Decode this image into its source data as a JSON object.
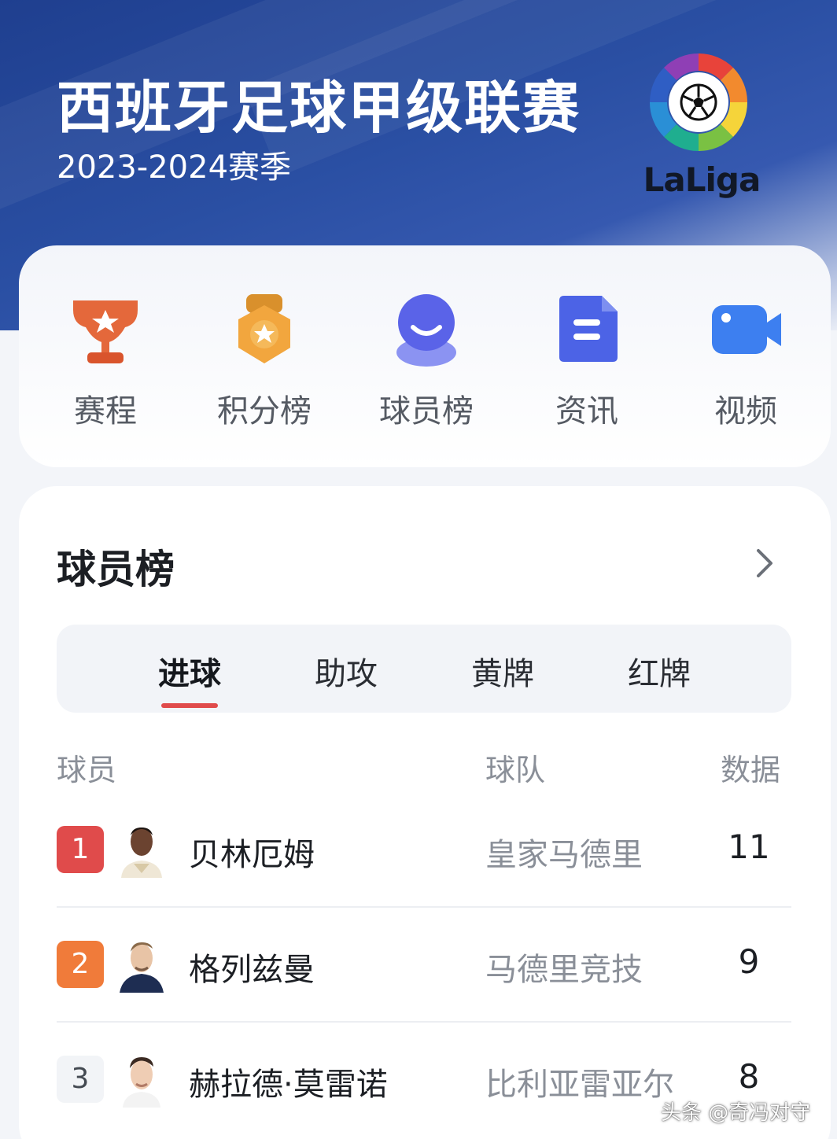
{
  "header": {
    "title": "西班牙足球甲级联赛",
    "season": "2023-2024赛季",
    "logo_text": "LaLiga"
  },
  "nav": [
    {
      "label": "赛程",
      "icon": "trophy-icon"
    },
    {
      "label": "积分榜",
      "icon": "medal-icon"
    },
    {
      "label": "球员榜",
      "icon": "player-icon"
    },
    {
      "label": "资讯",
      "icon": "news-icon"
    },
    {
      "label": "视频",
      "icon": "video-camera-icon"
    }
  ],
  "leaderboard": {
    "title": "球员榜",
    "tabs": [
      "进球",
      "助攻",
      "黄牌",
      "红牌"
    ],
    "active_tab": "进球",
    "columns": {
      "player": "球员",
      "team": "球队",
      "stat": "数据"
    },
    "rows": [
      {
        "rank": "1",
        "name": "贝林厄姆",
        "team": "皇家马德里",
        "value": "11",
        "rank_color": "#e04b4b"
      },
      {
        "rank": "2",
        "name": "格列兹曼",
        "team": "马德里竞技",
        "value": "9",
        "rank_color": "#f07b3a"
      },
      {
        "rank": "3",
        "name": "赫拉德·莫雷诺",
        "team": "比利亚雷亚尔",
        "value": "8",
        "rank_color": "#f2f4f7"
      }
    ]
  },
  "watermark": "头条 @奇冯对守",
  "colors": {
    "header_blue": "#2a4fa3",
    "accent_red": "#e04b4b",
    "accent_orange": "#f07b3a"
  }
}
